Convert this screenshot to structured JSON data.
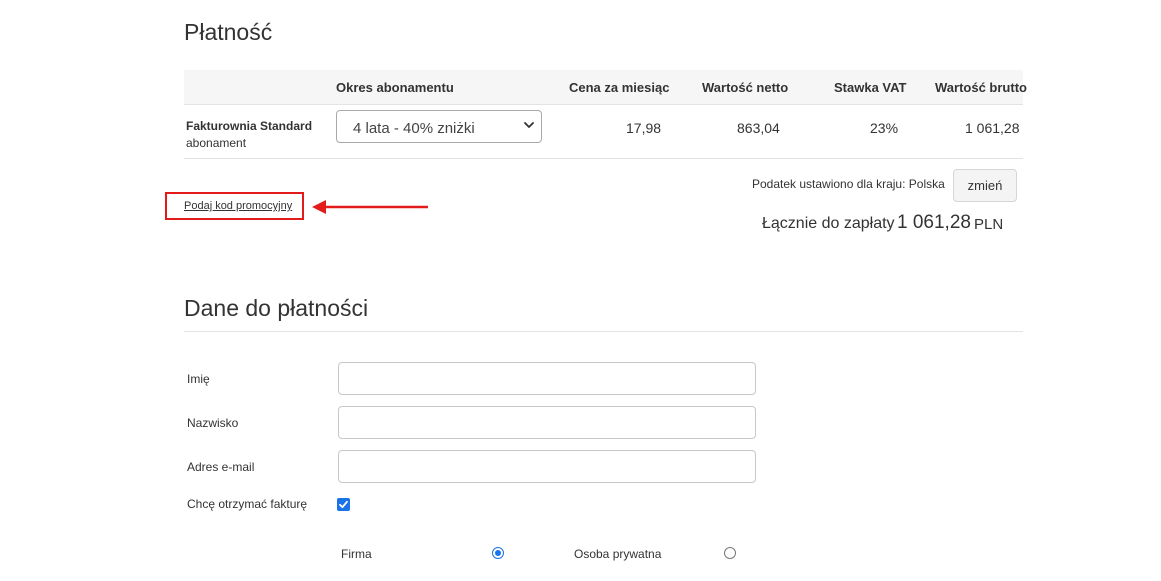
{
  "payment": {
    "title": "Płatność",
    "table": {
      "headers": [
        "",
        "Okres abonamentu",
        "Cena za miesiąc",
        "Wartość netto",
        "Stawka VAT",
        "Wartość brutto"
      ],
      "row": {
        "product_name": "Fakturownia Standard",
        "product_sub": "abonament",
        "period_selected": "4 lata - 40% zniżki",
        "price_month": "17,98",
        "net_value": "863,04",
        "vat_rate": "23%",
        "gross_value": "1 061,28"
      }
    },
    "tax_country_text": "Podatek ustawiono dla kraju: Polska",
    "change_button": "zmień",
    "promo_link": "Podaj kod promocyjny",
    "total_label": "Łącznie do zapłaty",
    "total_value": "1 061,28",
    "total_currency": "PLN"
  },
  "billing": {
    "title": "Dane do płatności",
    "first_name_label": "Imię",
    "first_name_value": "",
    "last_name_label": "Nazwisko",
    "last_name_value": "",
    "email_label": "Adres e-mail",
    "email_value": "",
    "invoice_label": "Chcę otrzymać fakturę",
    "invoice_checked": true,
    "type_company": "Firma",
    "type_private": "Osoba prywatna",
    "selected_type": "Firma"
  },
  "colors": {
    "accent": "#1a73e8",
    "highlight": "#e41b1b",
    "table_header_bg": "#f6f6f6"
  }
}
